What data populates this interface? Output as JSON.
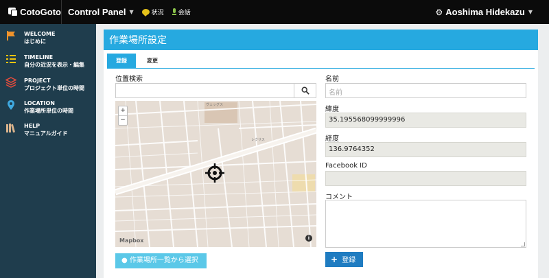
{
  "topbar": {
    "brand": "CotoGoto",
    "control_panel": "Control Panel",
    "nav_status": "状況",
    "nav_talk": "会話",
    "user_name": "Aoshima Hidekazu"
  },
  "sidebar": {
    "items": [
      {
        "title": "WELCOME",
        "sub": "はじめに",
        "icon": "flag-icon"
      },
      {
        "title": "TIMELINE",
        "sub": "自分の近況を表示・編集",
        "icon": "list-icon"
      },
      {
        "title": "PROJECT",
        "sub": "プロジェクト単位の時間",
        "icon": "layers-icon"
      },
      {
        "title": "LOCATION",
        "sub": "作業場所単位の時間",
        "icon": "map-pin-icon"
      },
      {
        "title": "HELP",
        "sub": "マニュアルガイド",
        "icon": "books-icon"
      }
    ]
  },
  "panel": {
    "title": "作業場所設定",
    "tabs": [
      "登録",
      "変更"
    ]
  },
  "form": {
    "location_search_label": "位置検索",
    "location_search_value": "",
    "name_label": "名前",
    "name_placeholder": "名前",
    "latitude_label": "緯度",
    "latitude_value": "35.195568099999996",
    "longitude_label": "経度",
    "longitude_value": "136.9764352",
    "facebook_label": "Facebook ID",
    "facebook_value": "",
    "comment_label": "コメント",
    "comment_value": "",
    "select_button": "作業場所一覧から選択",
    "register_button": "登録"
  },
  "map": {
    "zoom_in": "+",
    "zoom_out": "−",
    "attribution": "Mapbox",
    "info": "i",
    "labels": [
      "ヴェッグス",
      "レクサス"
    ]
  },
  "colors": {
    "accent": "#26a9e0",
    "sidebar_bg": "#1f3d4d",
    "topbar_bg": "#0b0b0b",
    "register_btn": "#1f7cc1",
    "select_btn": "#5bc8e8"
  }
}
